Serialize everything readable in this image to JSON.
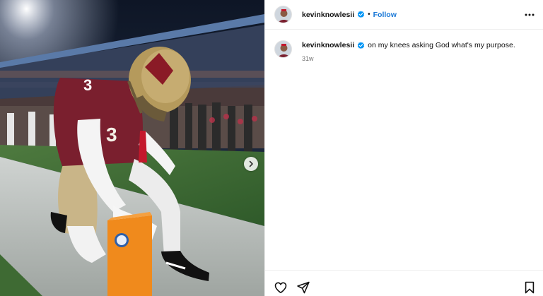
{
  "post": {
    "username": "kevinknowlesii",
    "follow_label": "Follow",
    "separator": "•",
    "caption": "on my knees asking God what's my purpose.",
    "timestamp": "31w",
    "jersey_number": "3"
  },
  "colors": {
    "follow_blue": "#1877d6",
    "verified_blue": "#0095f6",
    "jersey_garnet": "#7a1f2e",
    "helmet_gold": "#b59a5c"
  },
  "icons": {
    "verified": "verified-badge-icon",
    "more": "more-options-icon",
    "like": "heart-icon",
    "share": "send-icon",
    "save": "bookmark-icon",
    "next": "chevron-right-icon"
  }
}
